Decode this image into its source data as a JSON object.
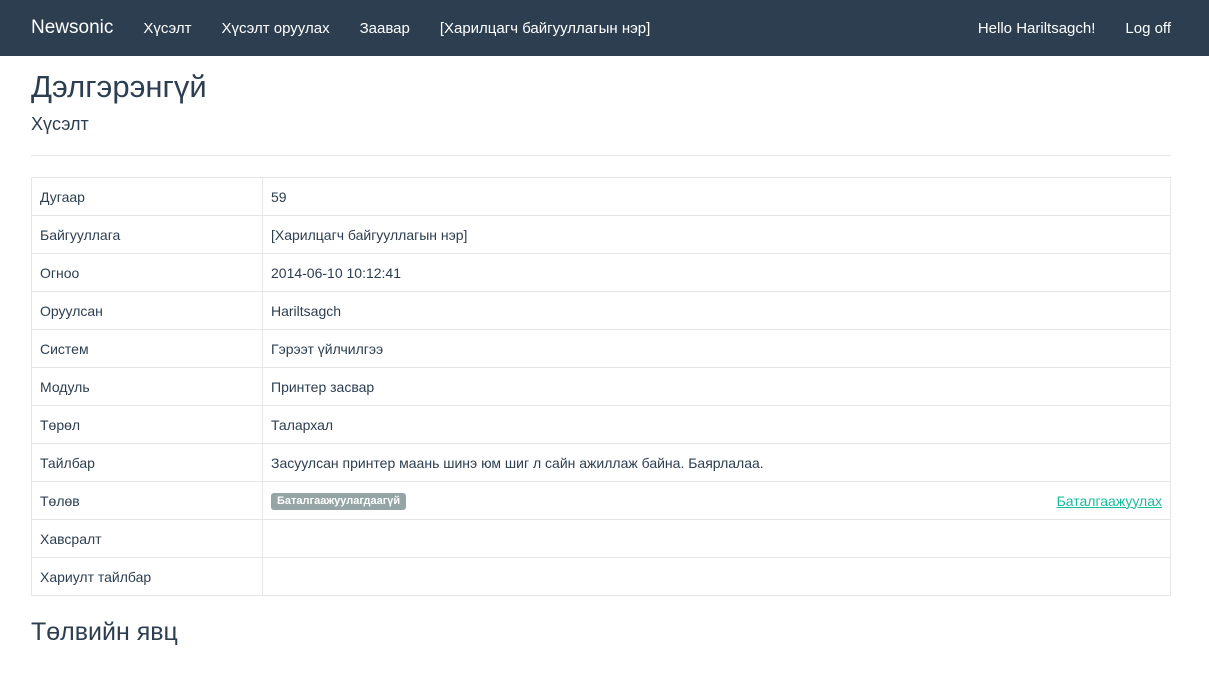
{
  "navbar": {
    "brand": "Newsonic",
    "links": [
      "Хүсэлт",
      "Хүсэлт оруулах",
      "Заавар",
      "[Харилцагч байгууллагын нэр]"
    ],
    "greeting": "Hello Hariltsagch!",
    "logoff": "Log off"
  },
  "page": {
    "title": "Дэлгэрэнгүй",
    "subtitle": "Хүсэлт"
  },
  "details": {
    "rows": [
      {
        "label": "Дугаар",
        "value": "59"
      },
      {
        "label": "Байгууллага",
        "value": "[Харилцагч байгууллагын нэр]"
      },
      {
        "label": "Огноо",
        "value": "2014-06-10 10:12:41"
      },
      {
        "label": "Оруулсан",
        "value": "Hariltsagch"
      },
      {
        "label": "Систем",
        "value": "Гэрээт үйлчилгээ"
      },
      {
        "label": "Модуль",
        "value": "Принтер засвар"
      },
      {
        "label": "Төрөл",
        "value": "Талархал"
      },
      {
        "label": "Тайлбар",
        "value": "Засуулсан принтер маань шинэ юм шиг л сайн ажиллаж байна. Баярлалаа."
      }
    ],
    "status": {
      "label": "Төлөв",
      "badge": "Баталгаажуулагдаагүй",
      "badge_color": "#95a5a6",
      "action": "Баталгаажуулах",
      "action_color": "#18bc9c"
    },
    "attachment": {
      "label": "Хавсралт",
      "value": ""
    },
    "reply": {
      "label": "Хариулт тайлбар",
      "value": ""
    }
  },
  "section": {
    "title": "Төлвийн явц"
  },
  "colors": {
    "navbar_bg": "#2c3e50",
    "text": "#2c3e50"
  }
}
